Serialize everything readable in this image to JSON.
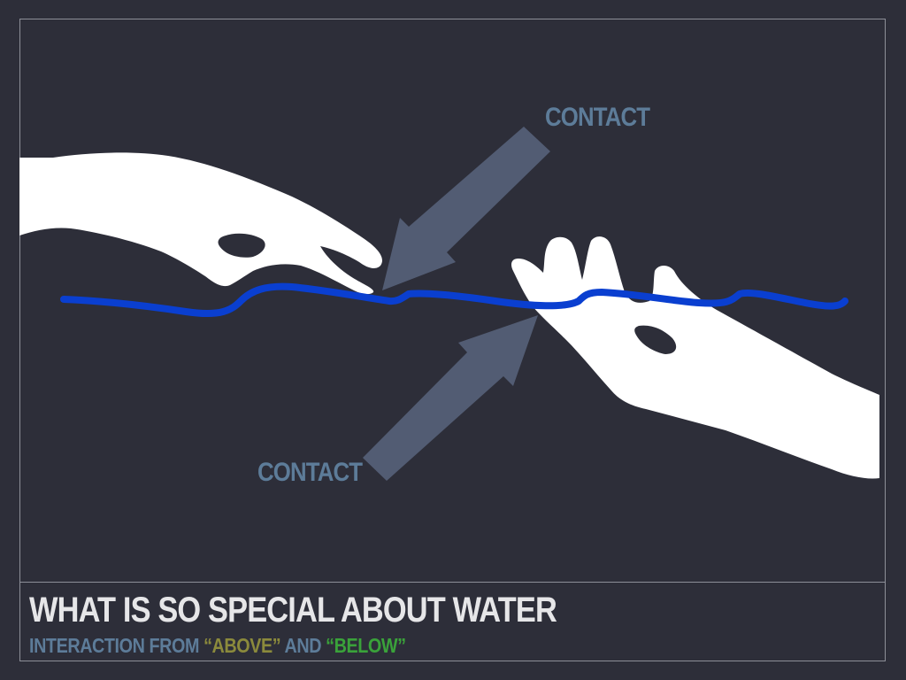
{
  "slide": {
    "title": "WHAT IS SO SPECIAL ABOUT WATER",
    "subtitle": {
      "part1": "INTERACTION FROM  ",
      "above": "“ABOVE”",
      "part2": " AND ",
      "below": "“BELOW”"
    }
  },
  "labels": {
    "contact_top": "CONTACT",
    "contact_bottom": "CONTACT"
  },
  "colors": {
    "background": "#2d2e39",
    "accent_blue": "#5d7c99",
    "water_line": "#0a3fd0",
    "arrow": "#56627a",
    "above": "#8b8a3c",
    "below": "#3aa23a"
  },
  "icons": {
    "upper_hand": "hand-reaching-icon",
    "lower_hand": "hand-reaching-icon",
    "arrows": "arrow-icon"
  }
}
